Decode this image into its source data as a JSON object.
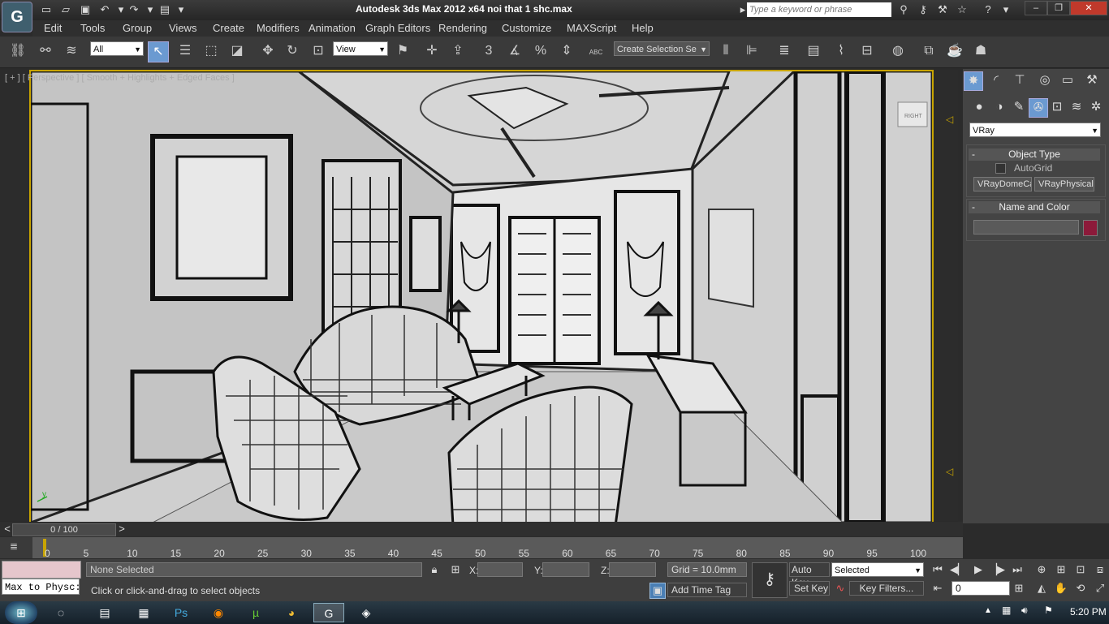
{
  "window": {
    "title": "Autodesk 3ds Max  2012 x64         noi that 1 shc.max",
    "search_placeholder": "Type a keyword or phrase"
  },
  "menu": [
    "Edit",
    "Tools",
    "Group",
    "Views",
    "Create",
    "Modifiers",
    "Animation",
    "Graph Editors",
    "Rendering",
    "Customize",
    "MAXScript",
    "Help"
  ],
  "toolbar": {
    "selection_filter": "All",
    "reference_coord": "View",
    "named_selection": "Create Selection Se",
    "snap_label": "3",
    "abc_label": "ABC"
  },
  "viewport": {
    "label": "[ + ] [ Perspective ] [ Smooth + Highlights + Edged Faces ]",
    "viewcube_label": "RIGHT",
    "axis_label": "y"
  },
  "command_panel": {
    "renderer": "VRay",
    "object_type_title": "Object Type",
    "autogrid_label": "AutoGrid",
    "buttons": [
      "VRayDomeCamera",
      "VRayPhysicalCam"
    ],
    "name_color_title": "Name and Color",
    "name_value": "",
    "color": "#8c1a3a"
  },
  "timeline": {
    "slider": "0 / 100",
    "ticks": [
      "0",
      "5",
      "10",
      "15",
      "20",
      "25",
      "30",
      "35",
      "40",
      "45",
      "50",
      "55",
      "60",
      "65",
      "70",
      "75",
      "80",
      "85",
      "90",
      "95",
      "100"
    ]
  },
  "status": {
    "maxscript_text": "Max to Physc:",
    "selection_text": "None Selected",
    "prompt_text": "Click or click-and-drag to select objects",
    "x_label": "X:",
    "y_label": "Y:",
    "z_label": "Z:",
    "grid_text": "Grid = 10.0mm",
    "add_time_tag": "Add Time Tag",
    "auto_key": "Auto Key",
    "set_key": "Set Key",
    "key_mode": "Selected",
    "key_filters": "Key Filters...",
    "frame_value": "0"
  },
  "taskbar": {
    "time": "5:20 PM"
  }
}
